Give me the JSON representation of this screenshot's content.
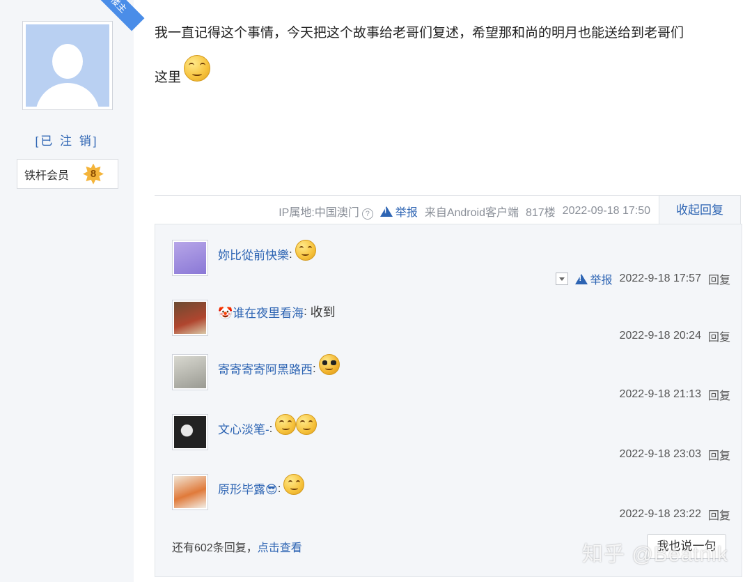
{
  "author": {
    "ribbon": "楼主",
    "display_name": "[已 注 销]",
    "member_title": "铁杆会员",
    "level": "8"
  },
  "post": {
    "line1": "我一直记得这个事情，今天把这个故事给老哥们复述，希望那和尚的明月也能送给到老哥们",
    "line2": "这里",
    "trailing_emoji": "smile-emoji"
  },
  "meta": {
    "ip": "IP属地:中国澳门",
    "report": "举报",
    "source": "来自Android客户端",
    "floor": "817楼",
    "datetime": "2022-09-18 17:50",
    "collapse": "收起回复"
  },
  "replies": [
    {
      "name": "妳比從前快樂",
      "text": "",
      "emojis": [
        "angry-emoji"
      ],
      "show_report": true,
      "report": "举报",
      "time": "2022-9-18 17:57",
      "reply": "回复"
    },
    {
      "name": "🤡谁在夜里看海",
      "text": "收到",
      "emojis": [],
      "show_report": false,
      "report": "",
      "time": "2022-9-18 20:24",
      "reply": "回复"
    },
    {
      "name": "寄寄寄寄阿黑路西",
      "text": "",
      "emojis": [
        "cool-emoji"
      ],
      "show_report": false,
      "report": "",
      "time": "2022-9-18 21:13",
      "reply": "回复"
    },
    {
      "name": "文心淡笔-",
      "text": "",
      "emojis": [
        "angry-emoji",
        "angry-emoji"
      ],
      "show_report": false,
      "report": "",
      "time": "2022-9-18 23:03",
      "reply": "回复"
    },
    {
      "name": "原形毕露😎",
      "text": "",
      "emojis": [
        "angry-emoji"
      ],
      "show_report": false,
      "report": "",
      "time": "2022-9-18 23:22",
      "reply": "回复"
    }
  ],
  "footer": {
    "more_prefix": "还有602条回复，",
    "more_link": "点击查看",
    "say_button": "我也说一句"
  },
  "watermark": "知乎 @Beatnik",
  "colors": {
    "link": "#2d64b3",
    "panel": "#f4f6f9",
    "ribbon": "#4a8de8"
  }
}
